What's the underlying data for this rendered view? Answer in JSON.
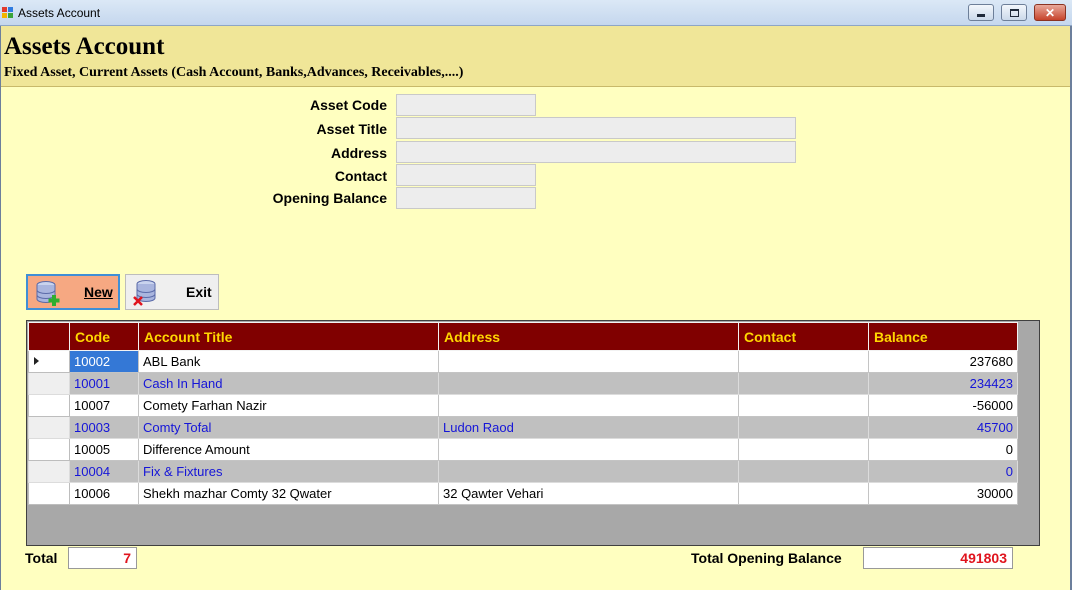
{
  "window": {
    "title": "Assets Account",
    "close_glyph": "✕"
  },
  "header": {
    "title": "Assets Account",
    "subtitle": "Fixed Asset, Current Assets (Cash Account, Banks,Advances, Receivables,....)"
  },
  "form": {
    "fields": [
      {
        "label": "Asset Code",
        "value": ""
      },
      {
        "label": "Asset Title",
        "value": ""
      },
      {
        "label": "Address",
        "value": ""
      },
      {
        "label": "Contact",
        "value": ""
      },
      {
        "label": "Opening Balance",
        "value": ""
      }
    ]
  },
  "toolbar": {
    "new_label": "New",
    "exit_label": "Exit"
  },
  "grid": {
    "columns": [
      "Code",
      "Account Title",
      "Address",
      "Contact",
      "Balance"
    ],
    "rows": [
      {
        "code": "10002",
        "title": "ABL Bank",
        "address": "",
        "contact": "",
        "balance": "237680"
      },
      {
        "code": "10001",
        "title": "Cash In Hand",
        "address": "",
        "contact": "",
        "balance": "234423"
      },
      {
        "code": "10007",
        "title": "Comety Farhan Nazir",
        "address": "",
        "contact": "",
        "balance": "-56000"
      },
      {
        "code": "10003",
        "title": "Comty Tofal",
        "address": "Ludon Raod",
        "contact": "",
        "balance": "45700"
      },
      {
        "code": "10005",
        "title": "Difference Amount",
        "address": "",
        "contact": "",
        "balance": "0"
      },
      {
        "code": "10004",
        "title": "Fix & Fixtures",
        "address": "",
        "contact": "",
        "balance": "0"
      },
      {
        "code": "10006",
        "title": "Shekh mazhar Comty 32 Qwater",
        "address": "32 Qawter Vehari",
        "contact": "",
        "balance": "30000"
      }
    ],
    "selected_row": 0
  },
  "footer": {
    "total_label": "Total",
    "total_value": "7",
    "opening_balance_label": "Total Opening Balance",
    "opening_balance_value": "491803"
  },
  "colors": {
    "header_bg": "#800000",
    "header_text": "#ffd700",
    "alt_row_text": "#1515d8",
    "total_text": "#e0141e"
  },
  "icons": {
    "app": "app-icon",
    "new": "database-add-icon",
    "exit": "database-delete-icon"
  }
}
